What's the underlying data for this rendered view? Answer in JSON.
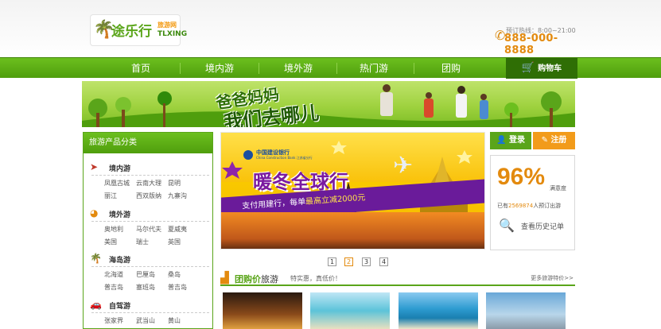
{
  "header": {
    "logo_cn": "途乐行",
    "logo_sub": "旅游网",
    "logo_en": "TLXING",
    "hotline_label": "预订热线：8:00~21:00",
    "hotline_number": "888-000-8888"
  },
  "nav": {
    "items": [
      "首页",
      "境内游",
      "境外游",
      "热门游",
      "团购"
    ],
    "cart_label": "购物车"
  },
  "banner": {
    "line1": "爸爸妈妈",
    "line2": "我们去哪儿"
  },
  "sidebar": {
    "title": "旅游产品分类",
    "categories": [
      {
        "label": "境内游",
        "links": [
          "凤凰古城",
          "云南大理",
          "昆明",
          "丽江",
          "西双版纳",
          "九寨沟"
        ]
      },
      {
        "label": "境外游",
        "links": [
          "奥地利",
          "马尔代夫",
          "夏威夷",
          "美国",
          "瑞士",
          "英国"
        ]
      },
      {
        "label": "海岛游",
        "links": [
          "北海道",
          "巴厘岛",
          "桑岛",
          "普吉岛",
          "塞班岛",
          "普吉岛"
        ]
      },
      {
        "label": "自驾游",
        "links": [
          "张家界",
          "武当山",
          "黄山"
        ]
      }
    ]
  },
  "slider": {
    "bank_name": "中国建设银行",
    "bank_en": "China Construction Bank 江苏省分行",
    "headline": "暖冬全球行",
    "subline_a": "支付用建行，每单",
    "subline_b": "最高立减2000元",
    "pages": [
      "1",
      "2",
      "3",
      "4"
    ],
    "active_page": "2"
  },
  "account": {
    "login": "登录",
    "register": "注册"
  },
  "stats": {
    "satisfaction": "96%",
    "satisfaction_label": "满意度",
    "booked_prefix": "已有",
    "booked_count": "2569874",
    "booked_suffix": "人预订出游",
    "history": "查看历史记单"
  },
  "groupbuy": {
    "title_a": "团购价",
    "title_b": "旅游",
    "tagline": "特实惠，真低价！",
    "more": "更多旅游特价>>"
  },
  "colors": {
    "brand_green": "#5aa51a",
    "accent_orange": "#e38a0e",
    "nav_dark_green": "#2f6e05"
  }
}
